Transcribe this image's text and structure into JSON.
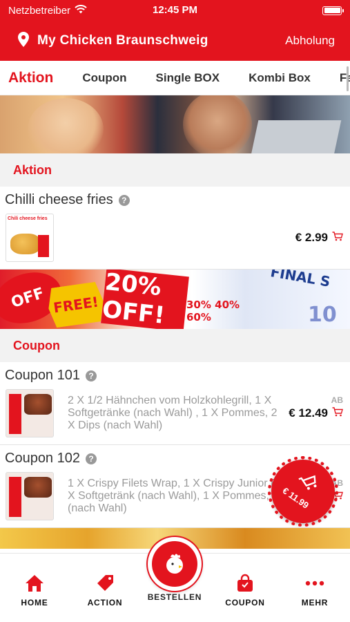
{
  "status_bar": {
    "carrier": "Netzbetreiber",
    "time": "12:45 PM"
  },
  "header": {
    "title": "My Chicken Braunschweig",
    "mode": "Abholung"
  },
  "tabs": [
    "Aktion",
    "Coupon",
    "Single BOX",
    "Kombi Box",
    "Fa"
  ],
  "banner2_text": {
    "s1": "OFF",
    "s2": "FREE!",
    "s3": "20% OFF!",
    "s4": "FINAL S",
    "s5": "30% 40% 60%",
    "s6": "10"
  },
  "sections": {
    "aktion": {
      "label": "Aktion",
      "items": [
        {
          "title": "Chilli cheese fries",
          "thumb_caption": "Chili cheese fries",
          "price": "€ 2.99"
        }
      ]
    },
    "coupon": {
      "label": "Coupon",
      "items": [
        {
          "title": "Coupon 101",
          "desc": "2 X 1/2 Hähnchen vom Holzkohlegrill, 1 X Softgetränke (nach Wahl) , 1 X Pommes, 2 X Dips (nach Wahl)",
          "price": "€ 12.49",
          "badge": "AB"
        },
        {
          "title": "Coupon 102",
          "desc": "1 X Crispy Filets Wrap, 1 X Crispy Junior Burger, 1 X Softgetränk (nach Wahl), 1 X Pommes, 1 X Dip (nach Wahl)",
          "badge": "AB"
        }
      ]
    }
  },
  "cart_badge": {
    "amount": "€ 11.99"
  },
  "bottom_nav": {
    "home": "HOME",
    "action": "ACTION",
    "order": "BESTELLEN",
    "coupon": "COUPON",
    "more": "MEHR"
  },
  "colors": {
    "brand_red": "#e3141e"
  },
  "icons": [
    "wifi-icon",
    "battery-icon",
    "location-pin-icon",
    "help-icon",
    "cart-icon",
    "home-icon",
    "tag-icon",
    "chicken-logo-icon",
    "bag-icon",
    "more-dots-icon"
  ]
}
